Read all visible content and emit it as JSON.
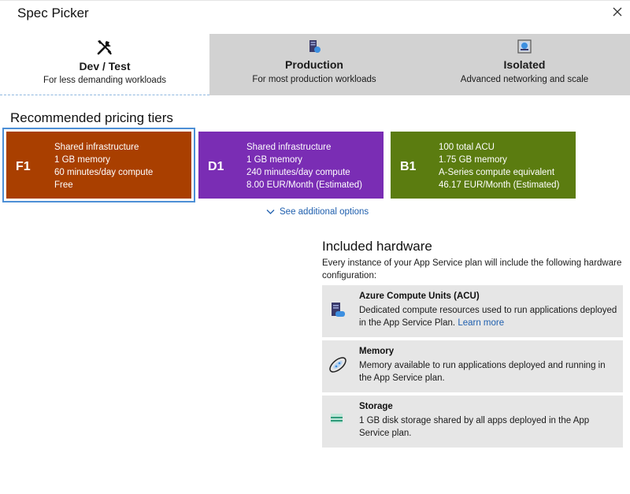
{
  "window": {
    "title": "Spec Picker"
  },
  "tabs": [
    {
      "title": "Dev / Test",
      "subtitle": "For less demanding workloads",
      "icon": "tools-icon",
      "active": true
    },
    {
      "title": "Production",
      "subtitle": "For most production workloads",
      "icon": "server-icon",
      "active": false
    },
    {
      "title": "Isolated",
      "subtitle": "Advanced networking and scale",
      "icon": "isolated-icon",
      "active": false
    }
  ],
  "recommended": {
    "title": "Recommended pricing tiers",
    "tiers": [
      {
        "code": "F1",
        "color": "#a93f00",
        "selected": true,
        "lines": [
          "Shared infrastructure",
          "1 GB memory",
          "60 minutes/day compute",
          "Free"
        ]
      },
      {
        "code": "D1",
        "color": "#7a2db4",
        "selected": false,
        "lines": [
          "Shared infrastructure",
          "1 GB memory",
          "240 minutes/day compute",
          "8.00 EUR/Month (Estimated)"
        ]
      },
      {
        "code": "B1",
        "color": "#5b7c10",
        "selected": false,
        "lines": [
          "100 total ACU",
          "1.75 GB memory",
          "A-Series compute equivalent",
          "46.17 EUR/Month (Estimated)"
        ]
      }
    ],
    "more_label": "See additional options"
  },
  "hardware": {
    "title": "Included hardware",
    "description": "Every instance of your App Service plan will include the following hardware configuration:",
    "items": [
      {
        "name": "Azure Compute Units (ACU)",
        "text": "Dedicated compute resources used to run applications deployed in the App Service Plan.",
        "link": "Learn more",
        "icon": "compute-icon"
      },
      {
        "name": "Memory",
        "text": "Memory available to run applications deployed and running in the App Service plan.",
        "icon": "memory-icon"
      },
      {
        "name": "Storage",
        "text": "1 GB disk storage shared by all apps deployed in the App Service plan.",
        "icon": "storage-icon"
      }
    ]
  },
  "colors": {
    "accent": "#1f5fae",
    "selection": "#4d8fd6",
    "inactive_tab": "#d2d2d2",
    "card_bg": "#e6e6e6"
  }
}
